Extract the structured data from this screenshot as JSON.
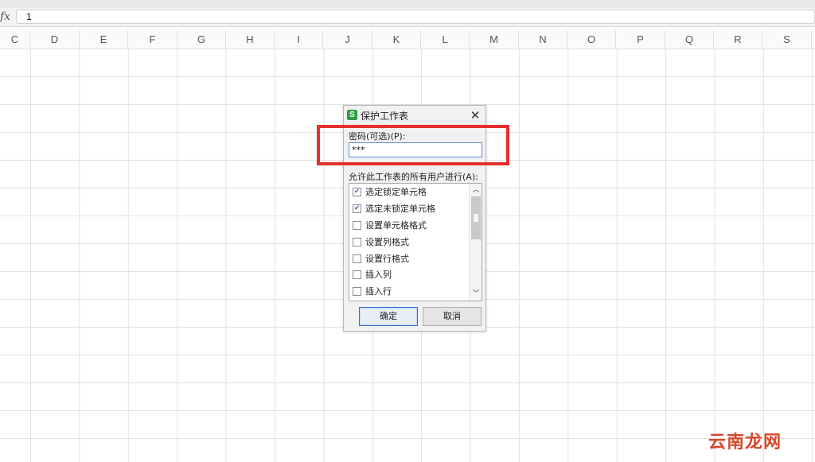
{
  "formula_bar": {
    "fx_label": "fx",
    "cell_value": "1"
  },
  "columns": [
    "C",
    "D",
    "E",
    "F",
    "G",
    "H",
    "I",
    "J",
    "K",
    "L",
    "M",
    "N",
    "O",
    "P",
    "Q",
    "R",
    "S"
  ],
  "dialog": {
    "title": "保护工作表",
    "logo_text": "S",
    "close_symbol": "✕",
    "password_label": "密码(可选)(P):",
    "password_value": "***",
    "allow_label": "允许此工作表的所有用户进行(A):",
    "permissions": [
      {
        "label": "选定锁定单元格",
        "checked": true
      },
      {
        "label": "选定未锁定单元格",
        "checked": true
      },
      {
        "label": "设置单元格格式",
        "checked": false
      },
      {
        "label": "设置列格式",
        "checked": false
      },
      {
        "label": "设置行格式",
        "checked": false
      },
      {
        "label": "插入列",
        "checked": false
      },
      {
        "label": "插入行",
        "checked": false
      }
    ],
    "ok_label": "确定",
    "cancel_label": "取消"
  },
  "watermark": "云南龙网",
  "colors": {
    "highlight": "#e53030",
    "logo": "#2ea043",
    "watermark": "#d9462c"
  }
}
